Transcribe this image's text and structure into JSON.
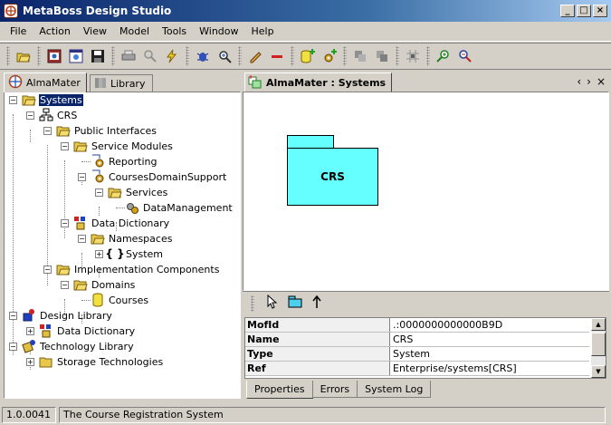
{
  "window": {
    "title": "MetaBoss Design Studio"
  },
  "menu": [
    "File",
    "Action",
    "View",
    "Model",
    "Tools",
    "Window",
    "Help"
  ],
  "toolbar": {
    "icons": [
      "open-icon",
      "view-icon",
      "properties-icon",
      "save-icon",
      "print-icon",
      "search-icon",
      "generate-icon",
      "debug-icon",
      "inspect-icon",
      "edit-icon",
      "delete-icon",
      "add-database-icon",
      "add-component-icon",
      "copy-icon",
      "paste-icon",
      "layout-icon",
      "zoom-in-icon",
      "zoom-out-icon"
    ]
  },
  "left_tabs": [
    {
      "label": "AlmaMater",
      "active": true
    },
    {
      "label": "Library",
      "active": false
    }
  ],
  "tree": [
    {
      "label": "Systems",
      "selected": true
    },
    {
      "label": "CRS"
    },
    {
      "label": "Public Interfaces"
    },
    {
      "label": "Service Modules"
    },
    {
      "label": "Reporting"
    },
    {
      "label": "CoursesDomainSupport"
    },
    {
      "label": "Services"
    },
    {
      "label": "DataManagement"
    },
    {
      "label": "Data Dictionary"
    },
    {
      "label": "Namespaces"
    },
    {
      "label": "System"
    },
    {
      "label": "Implementation Components"
    },
    {
      "label": "Domains"
    },
    {
      "label": "Courses"
    },
    {
      "label": "Design Library"
    },
    {
      "label": "Data Dictionary"
    },
    {
      "label": "Technology Library"
    },
    {
      "label": "Storage Technologies"
    }
  ],
  "diagram": {
    "tab_label": "AlmaMater : Systems",
    "package_label": "CRS"
  },
  "properties": [
    {
      "key": "MofId",
      "value": ".:0000000000000B9D"
    },
    {
      "key": "Name",
      "value": "CRS"
    },
    {
      "key": "Type",
      "value": "System"
    },
    {
      "key": "Ref",
      "value": "Enterprise/systems[CRS]"
    }
  ],
  "bottom_tabs": [
    {
      "label": "Properties",
      "active": true
    },
    {
      "label": "Errors",
      "active": false
    },
    {
      "label": "System Log",
      "active": false
    }
  ],
  "status": {
    "version": "1.0.0041",
    "message": "The Course Registration System"
  }
}
